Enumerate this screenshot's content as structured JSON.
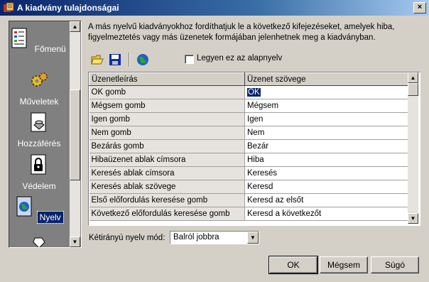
{
  "window": {
    "title": "A kiadvány tulajdonságai",
    "close_label": "×"
  },
  "nav": {
    "items": [
      {
        "label": "Főmenü",
        "icon": "document-list-icon"
      },
      {
        "label": "Műveletek",
        "icon": "gears-icon"
      },
      {
        "label": "Hozzáférés",
        "icon": "disk-access-icon"
      },
      {
        "label": "Védelem",
        "icon": "lock-icon"
      },
      {
        "label": "Nyelv",
        "icon": "globe-icon"
      }
    ],
    "selected": "Nyelv"
  },
  "description": "A más nyelvű kiadványokhoz fordíthatjuk le a következő kifejezéseket, amelyek hiba, figyelmeztetés vagy más üzenetek formájában jelenhetnek meg a kiadványban.",
  "toolbar": {
    "icons": [
      "open-folder-icon",
      "save-disk-icon",
      "globe-icon"
    ],
    "default_language_label": "Legyen ez az alapnyelv",
    "default_language_checked": false
  },
  "grid": {
    "columns": [
      "Üzenetleírás",
      "Üzenet szövege"
    ],
    "rows": [
      {
        "desc": "OK gomb",
        "text": "OK"
      },
      {
        "desc": "Mégsem gomb",
        "text": "Mégsem"
      },
      {
        "desc": "Igen gomb",
        "text": "Igen"
      },
      {
        "desc": "Nem gomb",
        "text": "Nem"
      },
      {
        "desc": "Bezárás gomb",
        "text": "Bezár"
      },
      {
        "desc": "Hibaüzenet ablak címsora",
        "text": "Hiba"
      },
      {
        "desc": "Keresés ablak címsora",
        "text": "Keresés"
      },
      {
        "desc": "Keresés ablak szövege",
        "text": "Keresd"
      },
      {
        "desc": "Első előfordulás keresése gomb",
        "text": "Keresd az elsőt"
      },
      {
        "desc": "Következő előfordulás keresése gomb",
        "text": "Keresd a következőt"
      }
    ],
    "selected_row": 0
  },
  "bidi": {
    "label": "Kétirányú nyelv mód:",
    "value": "Balról jobbra"
  },
  "buttons": {
    "ok": "OK",
    "cancel": "Mégsem",
    "help": "Súgó"
  }
}
